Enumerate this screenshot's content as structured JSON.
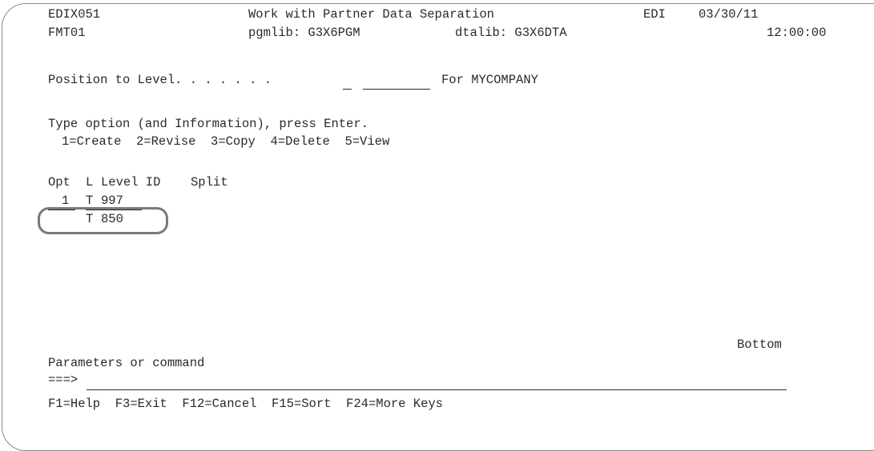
{
  "header": {
    "program": "EDIX051",
    "title": "Work with Partner Data Separation",
    "system": "EDI",
    "date": "03/30/11",
    "format": "FMT01",
    "pgmlib": "pgmlib: G3X6PGM",
    "dtalib": "dtalib: G3X6DTA",
    "time": "12:00:00"
  },
  "position": {
    "label": "Position to Level. . . . . . .",
    "level_code_value": "",
    "level_id_value": "",
    "company": "For MYCOMPANY"
  },
  "instructions": {
    "line1": "Type option (and Information), press Enter.",
    "options": "1=Create  2=Revise  3=Copy  4=Delete  5=View"
  },
  "table": {
    "headers": {
      "opt": "Opt",
      "l": "L",
      "level_id": "Level ID",
      "split": "Split"
    },
    "rows": [
      {
        "opt": "1",
        "l": "T",
        "level_id": "997"
      },
      {
        "opt": "",
        "l": "T",
        "level_id": "850"
      }
    ]
  },
  "status": {
    "bottom": "Bottom"
  },
  "command": {
    "label": "Parameters or command",
    "prompt": "===>",
    "value": ""
  },
  "function_keys": "F1=Help  F3=Exit  F12=Cancel  F15=Sort  F24=More Keys"
}
